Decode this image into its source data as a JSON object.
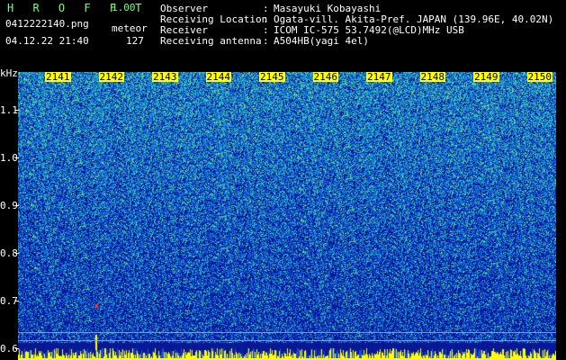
{
  "header": {
    "app_title": "H R O F F T",
    "version": "1.00",
    "filename": "0412222140.png",
    "mode": "meteor",
    "timestamp": "04.12.22 21:40",
    "count": "127"
  },
  "meta": {
    "observer_label": "Observer",
    "observer_value": "Masayuki Kobayashi",
    "location_label": "Receiving Location",
    "location_value": "Ogata-vill. Akita-Pref. JAPAN (139.96E, 40.02N)",
    "receiver_label": "Receiver",
    "receiver_value": "ICOM IC-575 53.7492(@LCD)MHz USB",
    "antenna_label": "Receiving antenna",
    "antenna_value": "A504HB(yagi 4el)",
    "separator": ":"
  },
  "chart_data": {
    "type": "heatmap",
    "ylabel": "kHz",
    "yticks": [
      "1.1",
      "1.0",
      "0.9",
      "0.8",
      "0.7",
      "0.6"
    ],
    "yrange": [
      0.58,
      1.18
    ],
    "xticks": [
      "2141",
      "2142",
      "2143",
      "2144",
      "2145",
      "2146",
      "2147",
      "2148",
      "2149",
      "2150"
    ],
    "colors": {
      "background": "#0a1a8c",
      "mid": "#1a4fd6",
      "high": "#20c0c0",
      "peak": "#ffff00",
      "hot": "#ff3030"
    }
  }
}
